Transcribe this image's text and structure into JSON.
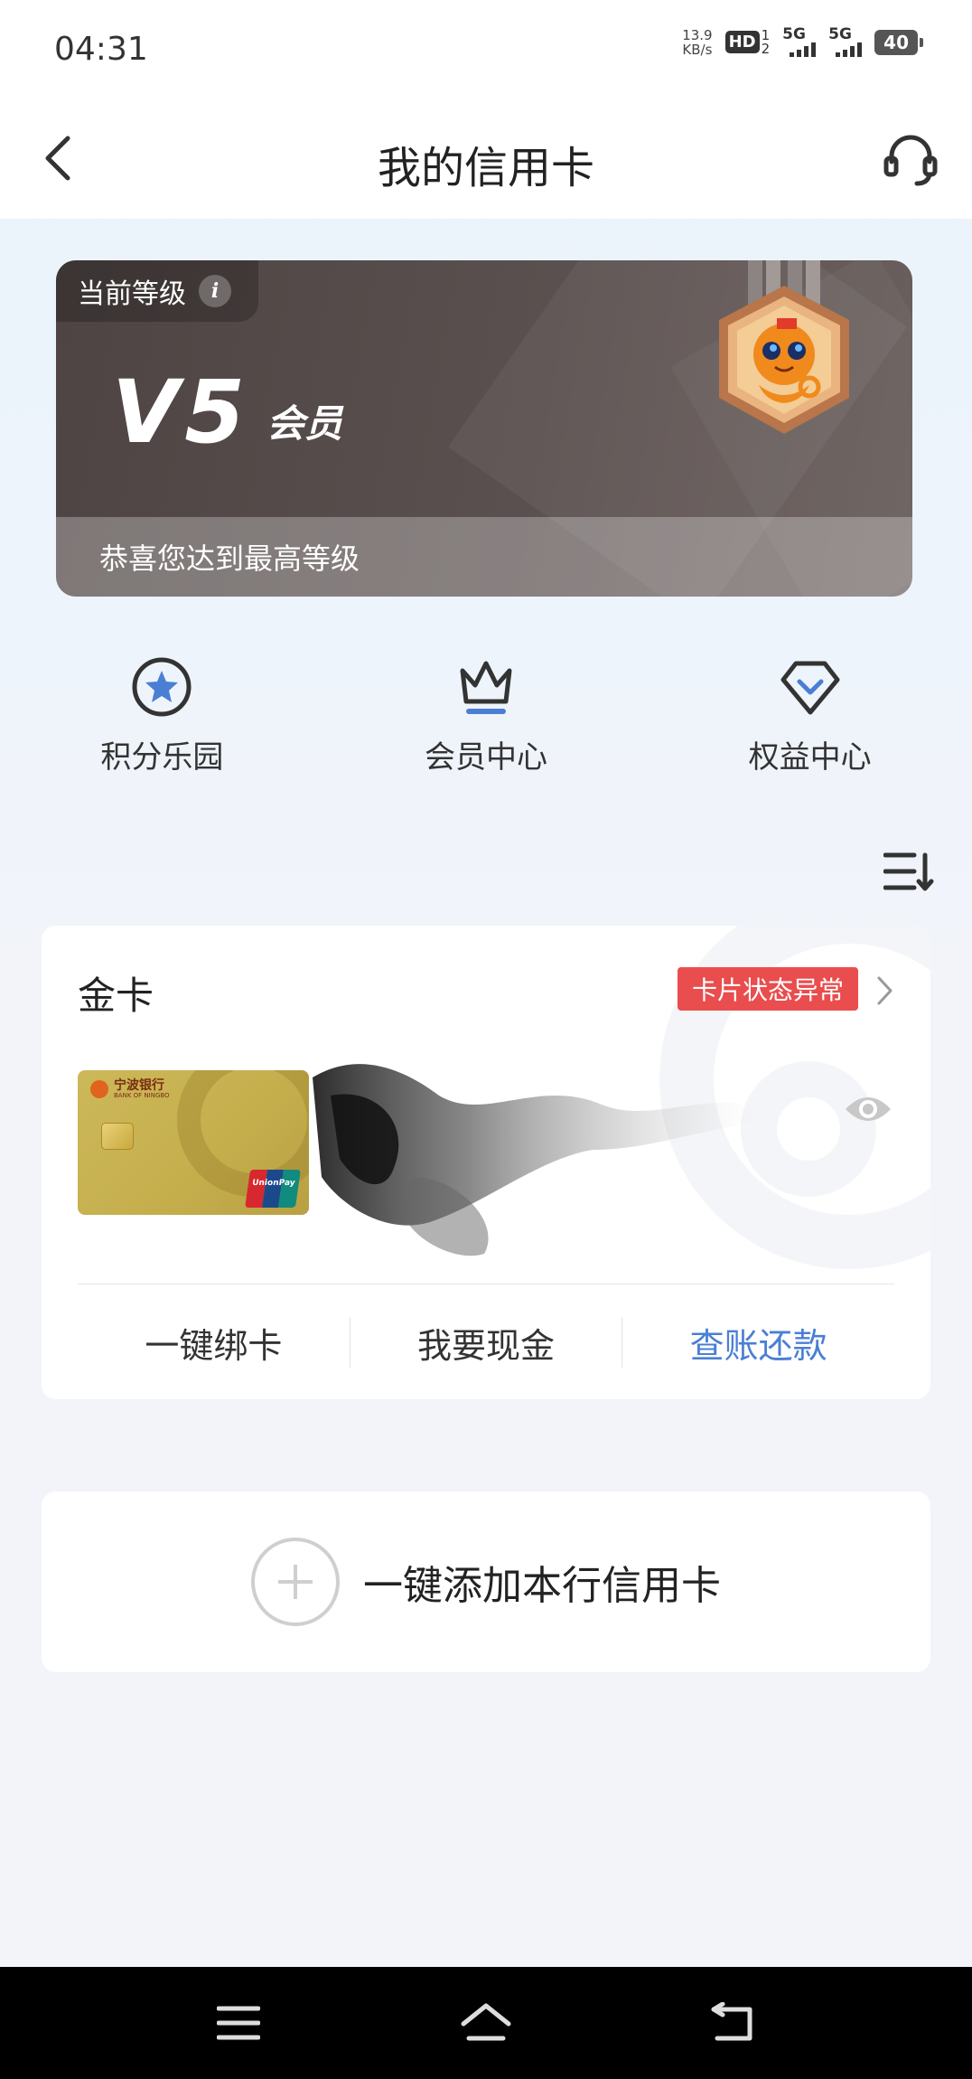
{
  "status_bar": {
    "time": "04:31",
    "net_speed_value": "13.9",
    "net_speed_unit": "KB/s",
    "hd_label": "HD",
    "hd_sub_top": "1",
    "hd_sub_bottom": "2",
    "signal1_label": "5G",
    "signal2_label": "5G",
    "battery": "40"
  },
  "nav": {
    "title": "我的信用卡",
    "back_icon": "chevron-left-icon",
    "service_icon": "headset-icon"
  },
  "level_banner": {
    "tag_label": "当前等级",
    "info_glyph": "i",
    "level_code": "V5",
    "level_suffix": "会员",
    "footer_text": "恭喜您达到最高等级",
    "medal_icon": "mascot-medal-icon"
  },
  "shortcuts": [
    {
      "label": "积分乐园",
      "icon": "star-circle-icon"
    },
    {
      "label": "会员中心",
      "icon": "crown-icon"
    },
    {
      "label": "权益中心",
      "icon": "diamond-icon"
    }
  ],
  "sort_icon": "sort-list-icon",
  "card": {
    "name": "金卡",
    "status": "卡片状态异常",
    "bank_name": "宁波银行",
    "bank_name_en": "BANK OF NINGBO",
    "network_label": "UnionPay",
    "network_sub": "银联",
    "visibility_icon": "eye-icon",
    "actions": [
      {
        "label": "一键绑卡"
      },
      {
        "label": "我要现金"
      },
      {
        "label": "查账还款"
      }
    ]
  },
  "add_card": {
    "label": "一键添加本行信用卡",
    "icon": "plus-circle-icon"
  },
  "system_nav": {
    "menu_icon": "menu-icon",
    "home_icon": "home-icon",
    "back_icon": "back-arrow-icon"
  },
  "colors": {
    "accent_blue": "#4a7fd4",
    "status_red": "#e94d4d",
    "card_gold": "#c9b14f",
    "banner_dark": "#554b4a"
  }
}
